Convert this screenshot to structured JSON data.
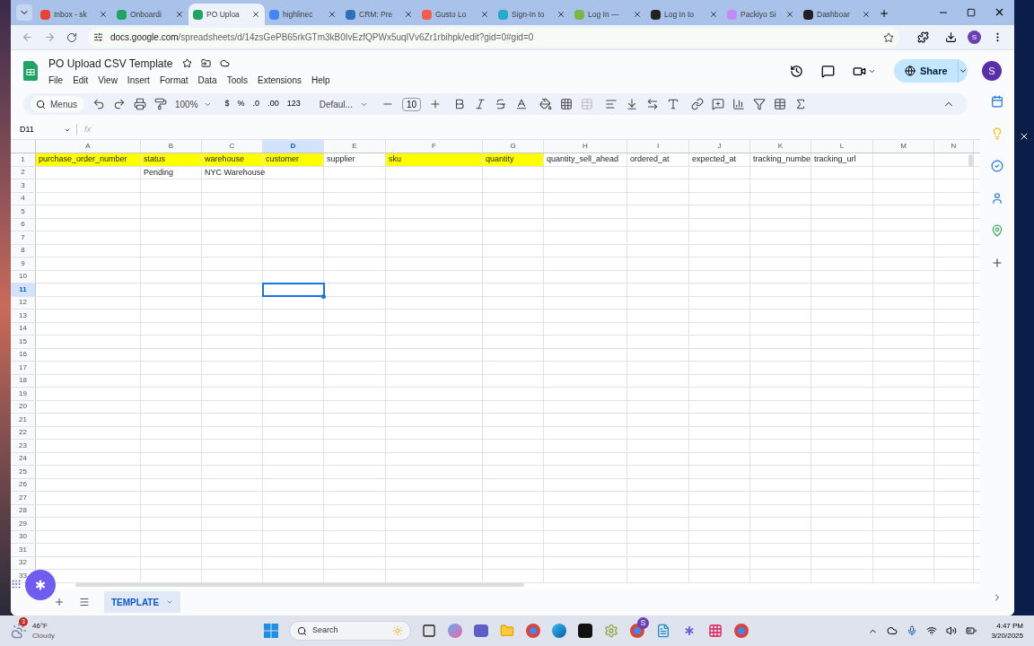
{
  "browser": {
    "tabs": [
      {
        "title": "Inbox - sk",
        "color": "#ea4335",
        "selected": false
      },
      {
        "title": "Onboardi",
        "color": "#1fa463",
        "selected": false
      },
      {
        "title": "PO Uploa",
        "color": "#1fa463",
        "selected": true
      },
      {
        "title": "highlinec",
        "color": "#4285f4",
        "selected": false
      },
      {
        "title": "CRM: Pre",
        "color": "#2f6fb5",
        "selected": false
      },
      {
        "title": "Gusto Lo",
        "color": "#f45d48",
        "selected": false
      },
      {
        "title": "Sign-In to",
        "color": "#27a9c9",
        "selected": false
      },
      {
        "title": "Log In —",
        "color": "#7ab648",
        "selected": false
      },
      {
        "title": "Log In to",
        "color": "#222222",
        "selected": false
      },
      {
        "title": "Packiyo Si",
        "color": "#c58af9",
        "selected": false
      },
      {
        "title": "Dashboar",
        "color": "#202124",
        "selected": false
      }
    ],
    "url_host": "docs.google.com",
    "url_path": "/spreadsheets/d/14zsGePB65rkGTm3kB0IvEzfQPWx5uqIVv6Zr1rbihpk/edit?gid=0#gid=0",
    "profile": "S"
  },
  "sheet": {
    "title": "PO Upload CSV Template",
    "menus": [
      "File",
      "Edit",
      "View",
      "Insert",
      "Format",
      "Data",
      "Tools",
      "Extensions",
      "Help"
    ],
    "share": "Share",
    "avatar": "S",
    "toolbar": {
      "search": "Menus",
      "zoom": "100%",
      "currency": "$",
      "percent": "%",
      "decrease_decimals": ".0",
      "increase_decimals": ".00",
      "number_format": "123",
      "font": "Defaul...",
      "font_size": "10"
    },
    "name_box": "D11",
    "fx": "fx",
    "columns": [
      {
        "label": "A",
        "selected": false
      },
      {
        "label": "B",
        "selected": false
      },
      {
        "label": "C",
        "selected": false
      },
      {
        "label": "D",
        "selected": true
      },
      {
        "label": "E",
        "selected": false
      },
      {
        "label": "F",
        "selected": false
      },
      {
        "label": "G",
        "selected": false
      },
      {
        "label": "H",
        "selected": false
      },
      {
        "label": "I",
        "selected": false
      },
      {
        "label": "J",
        "selected": false
      },
      {
        "label": "K",
        "selected": false
      },
      {
        "label": "L",
        "selected": false
      },
      {
        "label": "M",
        "selected": false
      },
      {
        "label": "N",
        "selected": false
      }
    ],
    "rows": [
      {
        "number": "1",
        "cells": [
          {
            "text": "purchase_order_number",
            "highlight": true
          },
          {
            "text": "status",
            "highlight": true
          },
          {
            "text": "warehouse",
            "highlight": true
          },
          {
            "text": "customer",
            "highlight": true
          },
          {
            "text": "supplier",
            "highlight": false
          },
          {
            "text": "sku",
            "highlight": true
          },
          {
            "text": "quantity",
            "highlight": true
          },
          {
            "text": "quantity_sell_ahead",
            "highlight": false
          },
          {
            "text": "ordered_at",
            "highlight": false
          },
          {
            "text": "expected_at",
            "highlight": false
          },
          {
            "text": "tracking_numbe",
            "highlight": false
          },
          {
            "text": "tracking_url",
            "highlight": false
          }
        ]
      },
      {
        "number": "2",
        "cells": [
          {},
          {
            "text": "Pending"
          },
          {
            "text": "NYC Warehouse"
          }
        ]
      },
      {
        "number": "3"
      },
      {
        "number": "4"
      },
      {
        "number": "5"
      },
      {
        "number": "6"
      },
      {
        "number": "7"
      },
      {
        "number": "8"
      },
      {
        "number": "9"
      },
      {
        "number": "10"
      },
      {
        "number": "11",
        "cells": [
          {},
          {},
          {},
          {
            "selected": true
          }
        ]
      },
      {
        "number": "12"
      },
      {
        "number": "13"
      },
      {
        "number": "14"
      },
      {
        "number": "15"
      },
      {
        "number": "16"
      },
      {
        "number": "17"
      },
      {
        "number": "18"
      },
      {
        "number": "19"
      },
      {
        "number": "20"
      },
      {
        "number": "21"
      },
      {
        "number": "22"
      },
      {
        "number": "23"
      },
      {
        "number": "24"
      },
      {
        "number": "25"
      },
      {
        "number": "26"
      },
      {
        "number": "27"
      },
      {
        "number": "28"
      },
      {
        "number": "29"
      },
      {
        "number": "30"
      },
      {
        "number": "31"
      },
      {
        "number": "32"
      },
      {
        "number": "33"
      }
    ],
    "sheet_tabs": [
      {
        "label": "TEMPLATE",
        "selected": true
      }
    ]
  },
  "taskbar": {
    "temperature": "46°F",
    "condition": "Cloudy",
    "weather_badge": "3",
    "search": "Search",
    "chrome_badge": "S",
    "time": "4:47 PM",
    "date": "3/20/2025"
  }
}
